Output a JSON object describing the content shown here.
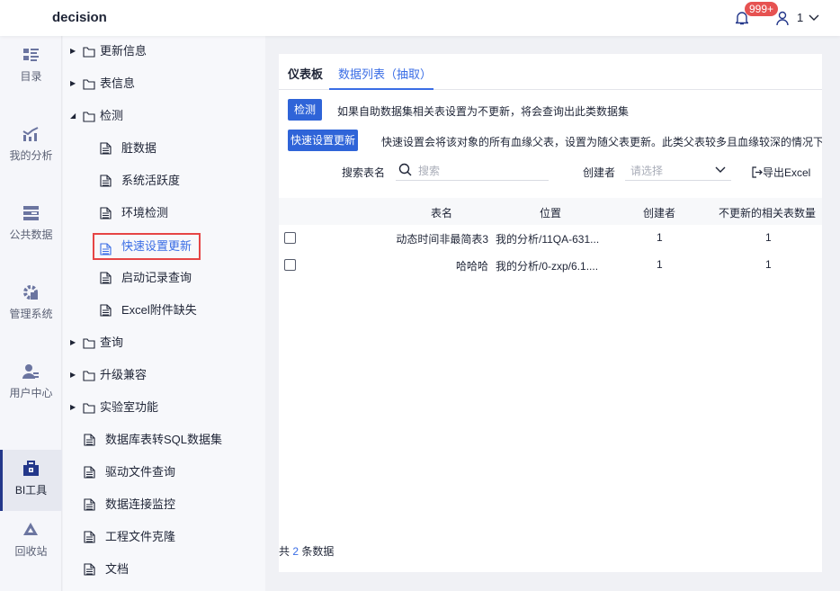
{
  "header": {
    "brand": "decision",
    "badge": "999+",
    "user": "1"
  },
  "nav": [
    {
      "label": "目录",
      "icon": "catalog-icon"
    },
    {
      "label": "我的分析",
      "icon": "analysis-icon"
    },
    {
      "label": "公共数据",
      "icon": "public-data-icon"
    },
    {
      "label": "管理系统",
      "icon": "gear-icon"
    },
    {
      "label": "用户中心",
      "icon": "user-center-icon"
    },
    {
      "label": "BI工具",
      "icon": "toolbox-icon",
      "active": true
    },
    {
      "label": "回收站",
      "icon": "recycle-icon"
    }
  ],
  "tree": [
    {
      "label": "更新信息",
      "type": "folder",
      "expanded": false,
      "level": 0
    },
    {
      "label": "表信息",
      "type": "folder",
      "expanded": false,
      "level": 0
    },
    {
      "label": "检测",
      "type": "folder",
      "expanded": true,
      "level": 0
    },
    {
      "label": "脏数据",
      "type": "file",
      "level": 1
    },
    {
      "label": "系统活跃度",
      "type": "file",
      "level": 1
    },
    {
      "label": "环境检测",
      "type": "file",
      "level": 1
    },
    {
      "label": "快速设置更新",
      "type": "file",
      "level": 1,
      "selected": true
    },
    {
      "label": "启动记录查询",
      "type": "file",
      "level": 1
    },
    {
      "label": "Excel附件缺失",
      "type": "file",
      "level": 1
    },
    {
      "label": "查询",
      "type": "folder",
      "expanded": false,
      "level": 0
    },
    {
      "label": "升级兼容",
      "type": "folder",
      "expanded": false,
      "level": 0
    },
    {
      "label": "实验室功能",
      "type": "folder",
      "expanded": false,
      "level": 0
    },
    {
      "label": "数据库表转SQL数据集",
      "type": "file",
      "level": 0
    },
    {
      "label": "驱动文件查询",
      "type": "file",
      "level": 0
    },
    {
      "label": "数据连接监控",
      "type": "file",
      "level": 0
    },
    {
      "label": "工程文件克隆",
      "type": "file",
      "level": 0
    },
    {
      "label": "文档",
      "type": "file",
      "level": 0
    }
  ],
  "main": {
    "tabs": [
      {
        "label": "仪表板"
      },
      {
        "label": "数据列表（抽取）",
        "active": true
      }
    ],
    "check_button": "检测",
    "check_desc": "如果自助数据集相关表设置为不更新，将会查询出此类数据集",
    "quick_button": "快速设置更新",
    "quick_desc": "快速设置会将该对象的所有血缘父表，设置为随父表更新。此类父表较多且血缘较深的情况下",
    "search_label": "搜索表名",
    "search_placeholder": "搜索",
    "creator_label": "创建者",
    "creator_placeholder": "请选择",
    "export_label": "导出Excel",
    "columns": [
      "表名",
      "位置",
      "创建者",
      "不更新的相关表数量"
    ],
    "rows": [
      [
        "动态时间非最简表3",
        "我的分析/11QA-631...",
        "1",
        "1"
      ],
      [
        "哈哈哈",
        "我的分析/0-zxp/6.1....",
        "1",
        "1"
      ]
    ],
    "footer": {
      "prefix": "共",
      "count": "2",
      "suffix": "条数据"
    }
  },
  "colors": {
    "accent": "#2f64d8",
    "selected_border": "#e64545",
    "badge": "#e65251"
  }
}
